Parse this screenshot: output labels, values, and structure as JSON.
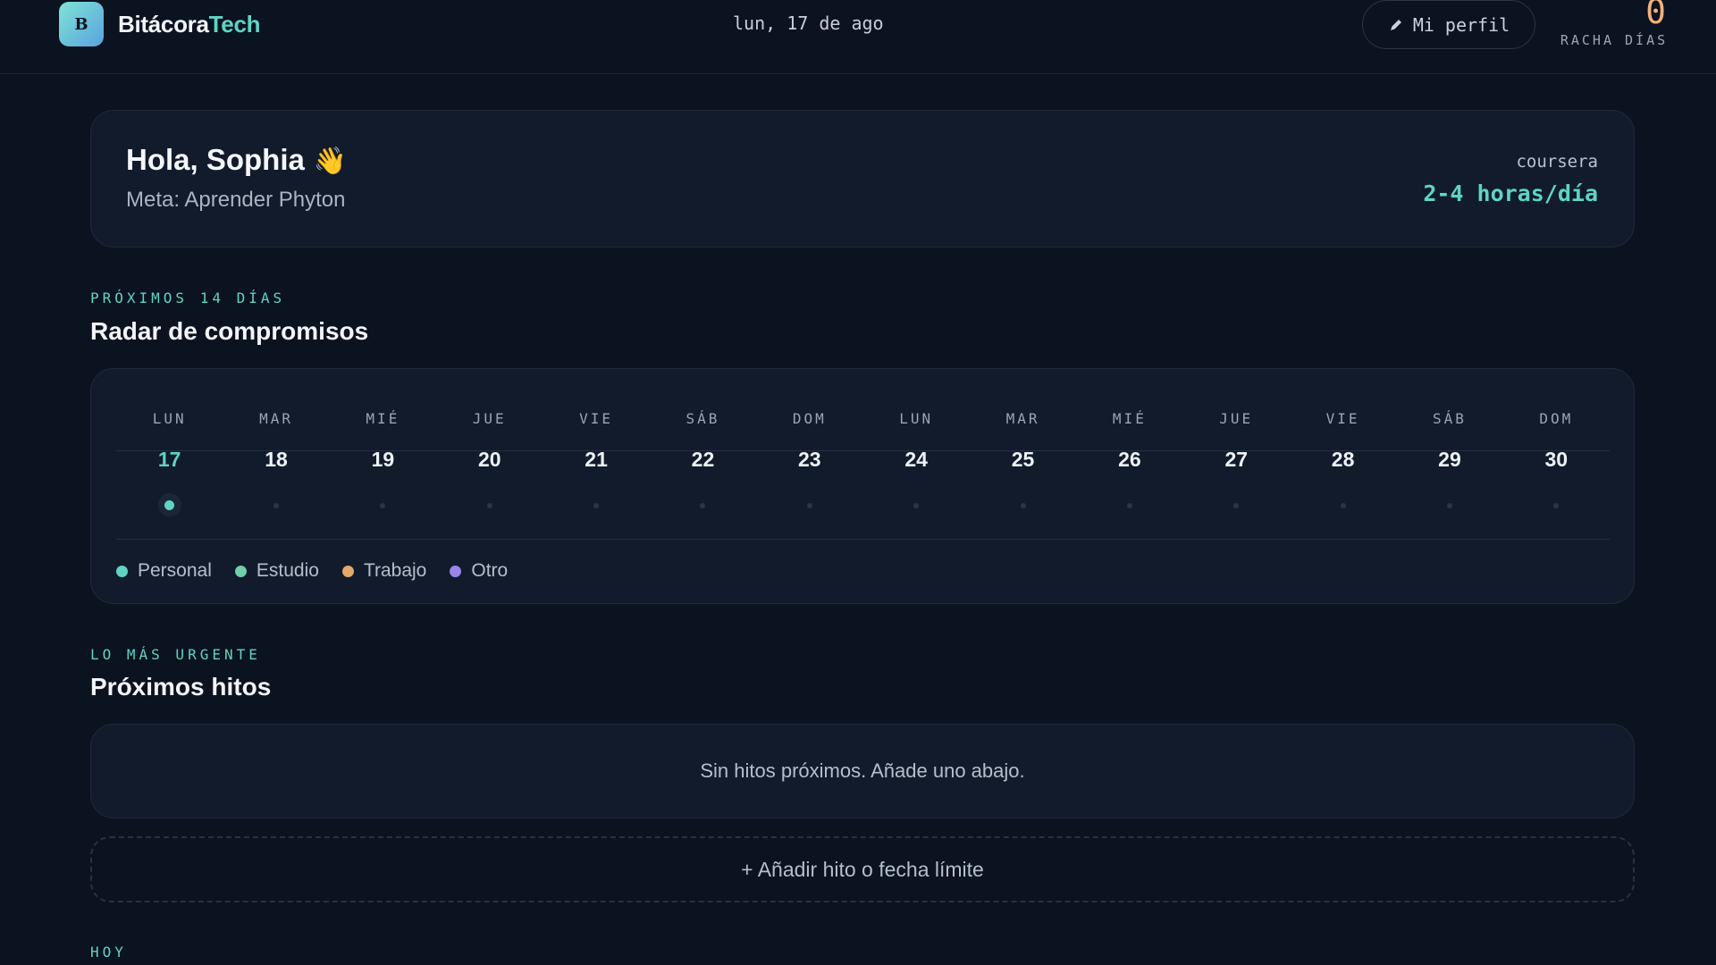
{
  "header": {
    "brand_a": "Bitácora",
    "brand_b": "Tech",
    "logo_letter": "B",
    "date": "lun, 17 de ago",
    "profile_label": "Mi perfil",
    "streak_value": "0",
    "streak_label": "RACHA DÍAS"
  },
  "greeting": {
    "title": "Hola, Sophia",
    "emoji": "👋",
    "goal": "Meta: Aprender Phyton",
    "source": "coursera",
    "hours": "2-4 horas/día"
  },
  "radar": {
    "eyebrow": "PRÓXIMOS 14 DÍAS",
    "title": "Radar de compromisos",
    "days": [
      {
        "dow": "LUN",
        "num": "17",
        "today": true
      },
      {
        "dow": "MAR",
        "num": "18"
      },
      {
        "dow": "MIÉ",
        "num": "19"
      },
      {
        "dow": "JUE",
        "num": "20"
      },
      {
        "dow": "VIE",
        "num": "21"
      },
      {
        "dow": "SÁB",
        "num": "22"
      },
      {
        "dow": "DOM",
        "num": "23"
      },
      {
        "dow": "LUN",
        "num": "24"
      },
      {
        "dow": "MAR",
        "num": "25"
      },
      {
        "dow": "MIÉ",
        "num": "26"
      },
      {
        "dow": "JUE",
        "num": "27"
      },
      {
        "dow": "VIE",
        "num": "28"
      },
      {
        "dow": "SÁB",
        "num": "29"
      },
      {
        "dow": "DOM",
        "num": "30"
      }
    ],
    "legend": [
      {
        "label": "Personal",
        "color": "#5fd4c4"
      },
      {
        "label": "Estudio",
        "color": "#6fcfa8"
      },
      {
        "label": "Trabajo",
        "color": "#e3a86b"
      },
      {
        "label": "Otro",
        "color": "#9a86e8"
      }
    ]
  },
  "milestones": {
    "eyebrow": "LO MÁS URGENTE",
    "title": "Próximos hitos",
    "empty_text": "Sin hitos próximos. Añade uno abajo.",
    "add_label": "+ Añadir hito o fecha límite"
  },
  "today": {
    "eyebrow": "HOY"
  }
}
